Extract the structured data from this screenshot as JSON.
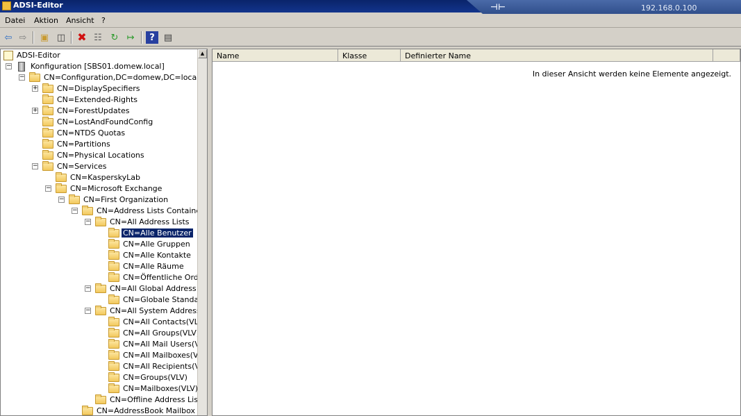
{
  "window": {
    "title": "ADSI-Editor"
  },
  "remote": {
    "ip": "192.168.0.100",
    "pin_symbol": "⊣⊢"
  },
  "menu": [
    "Datei",
    "Aktion",
    "Ansicht",
    "?"
  ],
  "toolbar": {
    "buttons": [
      "back-icon",
      "forward-icon",
      "up-folder-icon",
      "show-hide-tree-icon",
      "delete-icon",
      "properties-icon",
      "refresh-icon",
      "export-list-icon",
      "help-icon",
      "show-action-pane-icon"
    ]
  },
  "tree": {
    "root_label": "ADSI-Editor",
    "items": [
      {
        "label": "Konfiguration [SBS01.domew.local]",
        "expander": "⊟",
        "icon": "server-icon"
      },
      {
        "label": "CN=Configuration,DC=domew,DC=local",
        "expander": "⊟",
        "icon": "folder-icon"
      },
      {
        "label": "CN=DisplaySpecifiers",
        "expander": "⊞",
        "icon": "folder-icon"
      },
      {
        "label": "CN=Extended-Rights",
        "expander": "",
        "icon": "folder-icon"
      },
      {
        "label": "CN=ForestUpdates",
        "expander": "⊞",
        "icon": "folder-icon"
      },
      {
        "label": "CN=LostAndFoundConfig",
        "expander": "",
        "icon": "folder-icon"
      },
      {
        "label": "CN=NTDS Quotas",
        "expander": "",
        "icon": "folder-icon"
      },
      {
        "label": "CN=Partitions",
        "expander": "",
        "icon": "folder-icon"
      },
      {
        "label": "CN=Physical Locations",
        "expander": "",
        "icon": "folder-icon"
      },
      {
        "label": "CN=Services",
        "expander": "⊟",
        "icon": "folder-icon"
      },
      {
        "label": "CN=KasperskyLab",
        "expander": "",
        "icon": "folder-icon"
      },
      {
        "label": "CN=Microsoft Exchange",
        "expander": "⊟",
        "icon": "folder-icon"
      },
      {
        "label": "CN=First Organization",
        "expander": "⊟",
        "icon": "folder-icon"
      },
      {
        "label": "CN=Address Lists Container",
        "expander": "⊟",
        "icon": "folder-icon"
      },
      {
        "label": "CN=All Address Lists",
        "expander": "⊟",
        "icon": "folder-icon"
      },
      {
        "label": "CN=Alle Benutzer",
        "expander": "",
        "icon": "folder-icon",
        "selected": true
      },
      {
        "label": "CN=Alle Gruppen",
        "expander": "",
        "icon": "folder-icon"
      },
      {
        "label": "CN=Alle Kontakte",
        "expander": "",
        "icon": "folder-icon"
      },
      {
        "label": "CN=Alle Räume",
        "expander": "",
        "icon": "folder-icon"
      },
      {
        "label": "CN=Öffentliche Ordne",
        "expander": "",
        "icon": "folder-icon"
      },
      {
        "label": "CN=All Global Address List",
        "expander": "⊟",
        "icon": "folder-icon"
      },
      {
        "label": "CN=Globale Standarda",
        "expander": "",
        "icon": "folder-icon"
      },
      {
        "label": "CN=All System Address Lis",
        "expander": "⊟",
        "icon": "folder-icon"
      },
      {
        "label": "CN=All Contacts(VLV)",
        "expander": "",
        "icon": "folder-icon"
      },
      {
        "label": "CN=All Groups(VLV)",
        "expander": "",
        "icon": "folder-icon"
      },
      {
        "label": "CN=All Mail Users(VLV)",
        "expander": "",
        "icon": "folder-icon"
      },
      {
        "label": "CN=All Mailboxes(VLV)",
        "expander": "",
        "icon": "folder-icon"
      },
      {
        "label": "CN=All Recipients(VLV)",
        "expander": "",
        "icon": "folder-icon"
      },
      {
        "label": "CN=Groups(VLV)",
        "expander": "",
        "icon": "folder-icon"
      },
      {
        "label": "CN=Mailboxes(VLV)",
        "expander": "",
        "icon": "folder-icon"
      },
      {
        "label": "CN=Offline Address Lists",
        "expander": "",
        "icon": "folder-icon"
      },
      {
        "label": "CN=AddressBook Mailbox Polic",
        "expander": "",
        "icon": "folder-icon"
      }
    ]
  },
  "list": {
    "columns": [
      "Name",
      "Klasse",
      "Definierter Name"
    ],
    "empty_message": "In dieser Ansicht werden keine Elemente angezeigt."
  }
}
